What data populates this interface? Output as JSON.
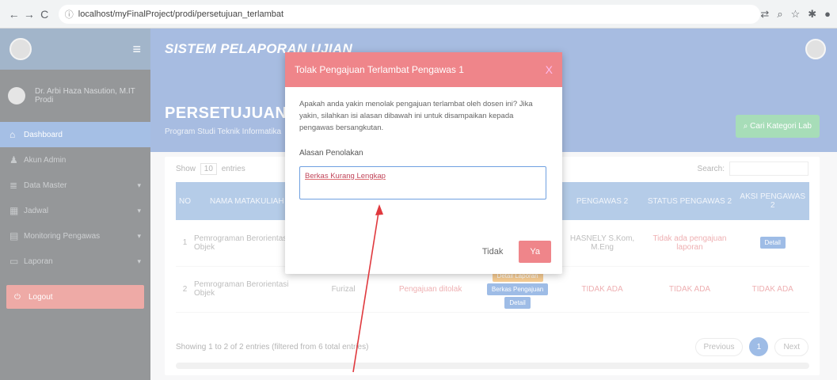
{
  "browser": {
    "url": "localhost/myFinalProject/prodi/persetujuan_terlambat"
  },
  "app": {
    "title": "SISTEM PELAPORAN UJIAN"
  },
  "sidebar": {
    "user_name": "Dr. Arbi Haza Nasution, M.IT",
    "user_sub": "Prodi",
    "items": [
      {
        "label": "Dashboard",
        "icon": "home-icon"
      },
      {
        "label": "Akun Admin",
        "icon": "user-icon"
      },
      {
        "label": "Data Master",
        "icon": "database-icon"
      },
      {
        "label": "Jadwal",
        "icon": "calendar-icon"
      },
      {
        "label": "Monitoring Pengawas",
        "icon": "monitor-icon"
      },
      {
        "label": "Laporan",
        "icon": "report-icon"
      }
    ],
    "logout": "Logout"
  },
  "page": {
    "title": "PERSETUJUAN TI",
    "subtitle": "Program Studi Teknik Informatika",
    "cari_button": "Cari Kategori Lab"
  },
  "table": {
    "show_label": "Show",
    "show_value": "10",
    "entries_label": "entries",
    "search_label": "Search:",
    "headers": [
      "NO",
      "NAMA MATAKULIAH",
      "",
      "",
      "",
      "PENGAWAS 2",
      "STATUS PENGAWAS 2",
      "AKSI PENGAWAS 2"
    ],
    "rows": [
      {
        "no": "1",
        "matkul": "Pemrograman Berorientasi Objek",
        "dosen": "",
        "status": "",
        "pengawas": "HASNELY S.Kom, M.Eng",
        "status2": "Tidak ada pengajuan laporan",
        "aksi": "Detail"
      },
      {
        "no": "2",
        "matkul": "Pemrograman Berorientasi Objek",
        "dosen": "Furizal",
        "status": "Pengajuan ditolak",
        "btn1": "Detail Laporan",
        "btn2": "Berkas Pengajuan",
        "btn3": "Detail",
        "pengawas": "TIDAK ADA",
        "status2": "TIDAK ADA",
        "aksi": "TIDAK ADA"
      }
    ],
    "footer": "Showing 1 to 2 of 2 entries (filtered from 6 total entries)",
    "prev": "Previous",
    "page": "1",
    "next": "Next"
  },
  "modal": {
    "title": "Tolak Pengajuan Terlambat Pengawas 1",
    "close": "X",
    "message": "Apakah anda yakin menolak pengajuan terlambat oleh dosen ini? Jika yakin, silahkan isi alasan dibawah ini untuk disampaikan kepada pengawas bersangkutan.",
    "reason_label": "Alasan Penolakan",
    "reason_value": "Berkas Kurang Lengkap",
    "cancel": "Tidak",
    "confirm": "Ya"
  }
}
